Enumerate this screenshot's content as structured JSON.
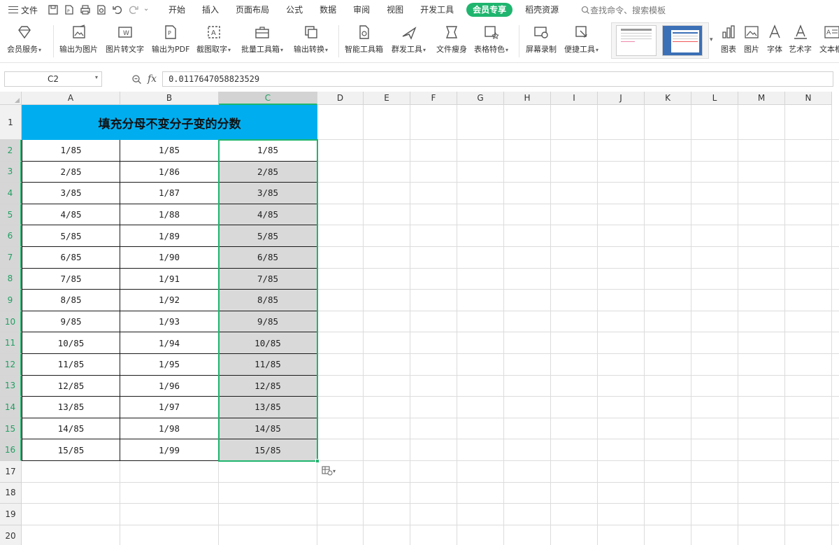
{
  "menu": {
    "file_label": "文件",
    "tabs": [
      "开始",
      "插入",
      "页面布局",
      "公式",
      "数据",
      "审阅",
      "视图",
      "开发工具",
      "会员专享",
      "稻壳资源"
    ],
    "active_tab": "会员专享",
    "search_placeholder": "查找命令、搜索模板"
  },
  "ribbon": {
    "items": [
      {
        "label": "会员服务",
        "icon": "diamond-icon",
        "dropdown": true
      },
      {
        "label": "输出为图片",
        "icon": "export-image-icon",
        "dropdown": false
      },
      {
        "label": "图片转文字",
        "icon": "image-to-text-icon",
        "dropdown": false
      },
      {
        "label": "输出为PDF",
        "icon": "export-pdf-icon",
        "dropdown": false
      },
      {
        "label": "截图取字",
        "icon": "screenshot-text-icon",
        "dropdown": true
      },
      {
        "label": "批量工具箱",
        "icon": "toolbox-icon",
        "dropdown": true
      },
      {
        "label": "输出转换",
        "icon": "convert-icon",
        "dropdown": true
      },
      {
        "label": "智能工具箱",
        "icon": "smart-toolbox-icon",
        "dropdown": false
      },
      {
        "label": "群发工具",
        "icon": "mass-send-icon",
        "dropdown": true
      },
      {
        "label": "文件瘦身",
        "icon": "file-slim-icon",
        "dropdown": false
      },
      {
        "label": "表格特色",
        "icon": "table-feature-icon",
        "dropdown": true
      },
      {
        "label": "屏幕录制",
        "icon": "screen-record-icon",
        "dropdown": false
      },
      {
        "label": "便捷工具",
        "icon": "handy-tools-icon",
        "dropdown": true
      },
      {
        "label": "图表",
        "icon": "chart-icon",
        "dropdown": false
      },
      {
        "label": "图片",
        "icon": "picture-icon",
        "dropdown": false
      },
      {
        "label": "字体",
        "icon": "font-icon",
        "dropdown": false
      },
      {
        "label": "艺术字",
        "icon": "wordart-icon",
        "dropdown": false
      },
      {
        "label": "文本框",
        "icon": "textbox-icon",
        "dropdown": false
      }
    ]
  },
  "formula_bar": {
    "cell_ref": "C2",
    "fx_label": "fx",
    "value": "0.0117647058823529"
  },
  "sheet": {
    "columns": [
      "A",
      "B",
      "C",
      "D",
      "E",
      "F",
      "G",
      "H",
      "I",
      "J",
      "K",
      "L",
      "M",
      "N"
    ],
    "selected_column": "C",
    "rows": [
      "1",
      "2",
      "3",
      "4",
      "5",
      "6",
      "7",
      "8",
      "9",
      "10",
      "11",
      "12",
      "13",
      "14",
      "15",
      "16",
      "17",
      "18",
      "19",
      "20"
    ],
    "title": "填充分母不变分子变的分数",
    "data": [
      [
        "1/85",
        "1/85",
        "1/85"
      ],
      [
        "2/85",
        "1/86",
        "2/85"
      ],
      [
        "3/85",
        "1/87",
        "3/85"
      ],
      [
        "4/85",
        "1/88",
        "4/85"
      ],
      [
        "5/85",
        "1/89",
        "5/85"
      ],
      [
        "6/85",
        "1/90",
        "6/85"
      ],
      [
        "7/85",
        "1/91",
        "7/85"
      ],
      [
        "8/85",
        "1/92",
        "8/85"
      ],
      [
        "9/85",
        "1/93",
        "9/85"
      ],
      [
        "10/85",
        "1/94",
        "10/85"
      ],
      [
        "11/85",
        "1/95",
        "11/85"
      ],
      [
        "12/85",
        "1/96",
        "12/85"
      ],
      [
        "13/85",
        "1/97",
        "13/85"
      ],
      [
        "14/85",
        "1/98",
        "14/85"
      ],
      [
        "15/85",
        "1/99",
        "15/85"
      ]
    ]
  },
  "colors": {
    "accent": "#1fb56e",
    "title_fill": "#00aeef",
    "selection_fill": "#d9d9d9"
  }
}
